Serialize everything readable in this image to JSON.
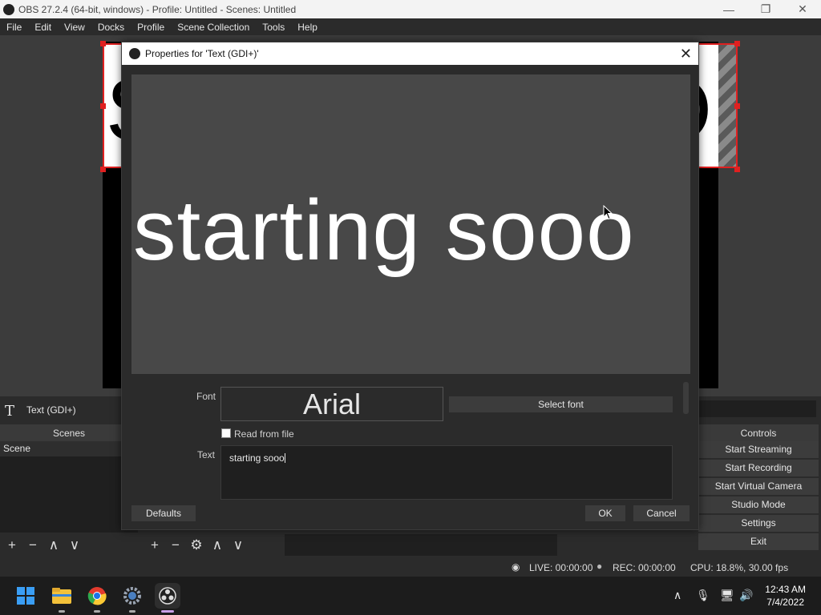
{
  "window": {
    "title": "OBS 27.2.4 (64-bit, windows) - Profile: Untitled - Scenes: Untitled",
    "minimize": "—",
    "restore": "❐",
    "close": "✕"
  },
  "menu": [
    "File",
    "Edit",
    "View",
    "Docks",
    "Profile",
    "Scene Collection",
    "Tools",
    "Help"
  ],
  "canvas": {
    "text_left": "S",
    "text_right": "O"
  },
  "source_bar": {
    "icon": "T",
    "label": "Text (GDI+)"
  },
  "docks": {
    "scenes_header": "Scenes",
    "scene_items": [
      "Scene"
    ],
    "controls_header": "Controls",
    "controls": [
      "Start Streaming",
      "Start Recording",
      "Start Virtual Camera",
      "Studio Mode",
      "Settings",
      "Exit"
    ]
  },
  "toolbar_icons": {
    "add": "+",
    "remove": "−",
    "settings": "⚙",
    "up": "∧",
    "down": "∨"
  },
  "status": {
    "live": "LIVE: 00:00:00",
    "rec": "REC: 00:00:00",
    "cpu": "CPU: 18.8%, 30.00 fps"
  },
  "dialog": {
    "title": "Properties for 'Text (GDI+)'",
    "close": "✕",
    "preview_text": "starting sooo",
    "font_label": "Font",
    "font_name": "Arial",
    "select_font": "Select font",
    "read_from_file": "Read from file",
    "read_from_file_checked": false,
    "text_label": "Text",
    "text_value": "starting sooo",
    "defaults": "Defaults",
    "ok": "OK",
    "cancel": "Cancel"
  },
  "taskbar": {
    "time": "12:43 AM",
    "date": "7/4/2022",
    "icons": [
      "windows-start-icon",
      "file-explorer-icon",
      "chrome-icon",
      "settings-icon",
      "obs-icon"
    ],
    "tray": [
      "chevron-up-icon",
      "microphone-icon",
      "network-icon",
      "volume-icon"
    ]
  },
  "colors": {
    "selection_red": "#e02020",
    "dialog_bg": "#2b2b2b",
    "preview_bg": "#484848"
  }
}
